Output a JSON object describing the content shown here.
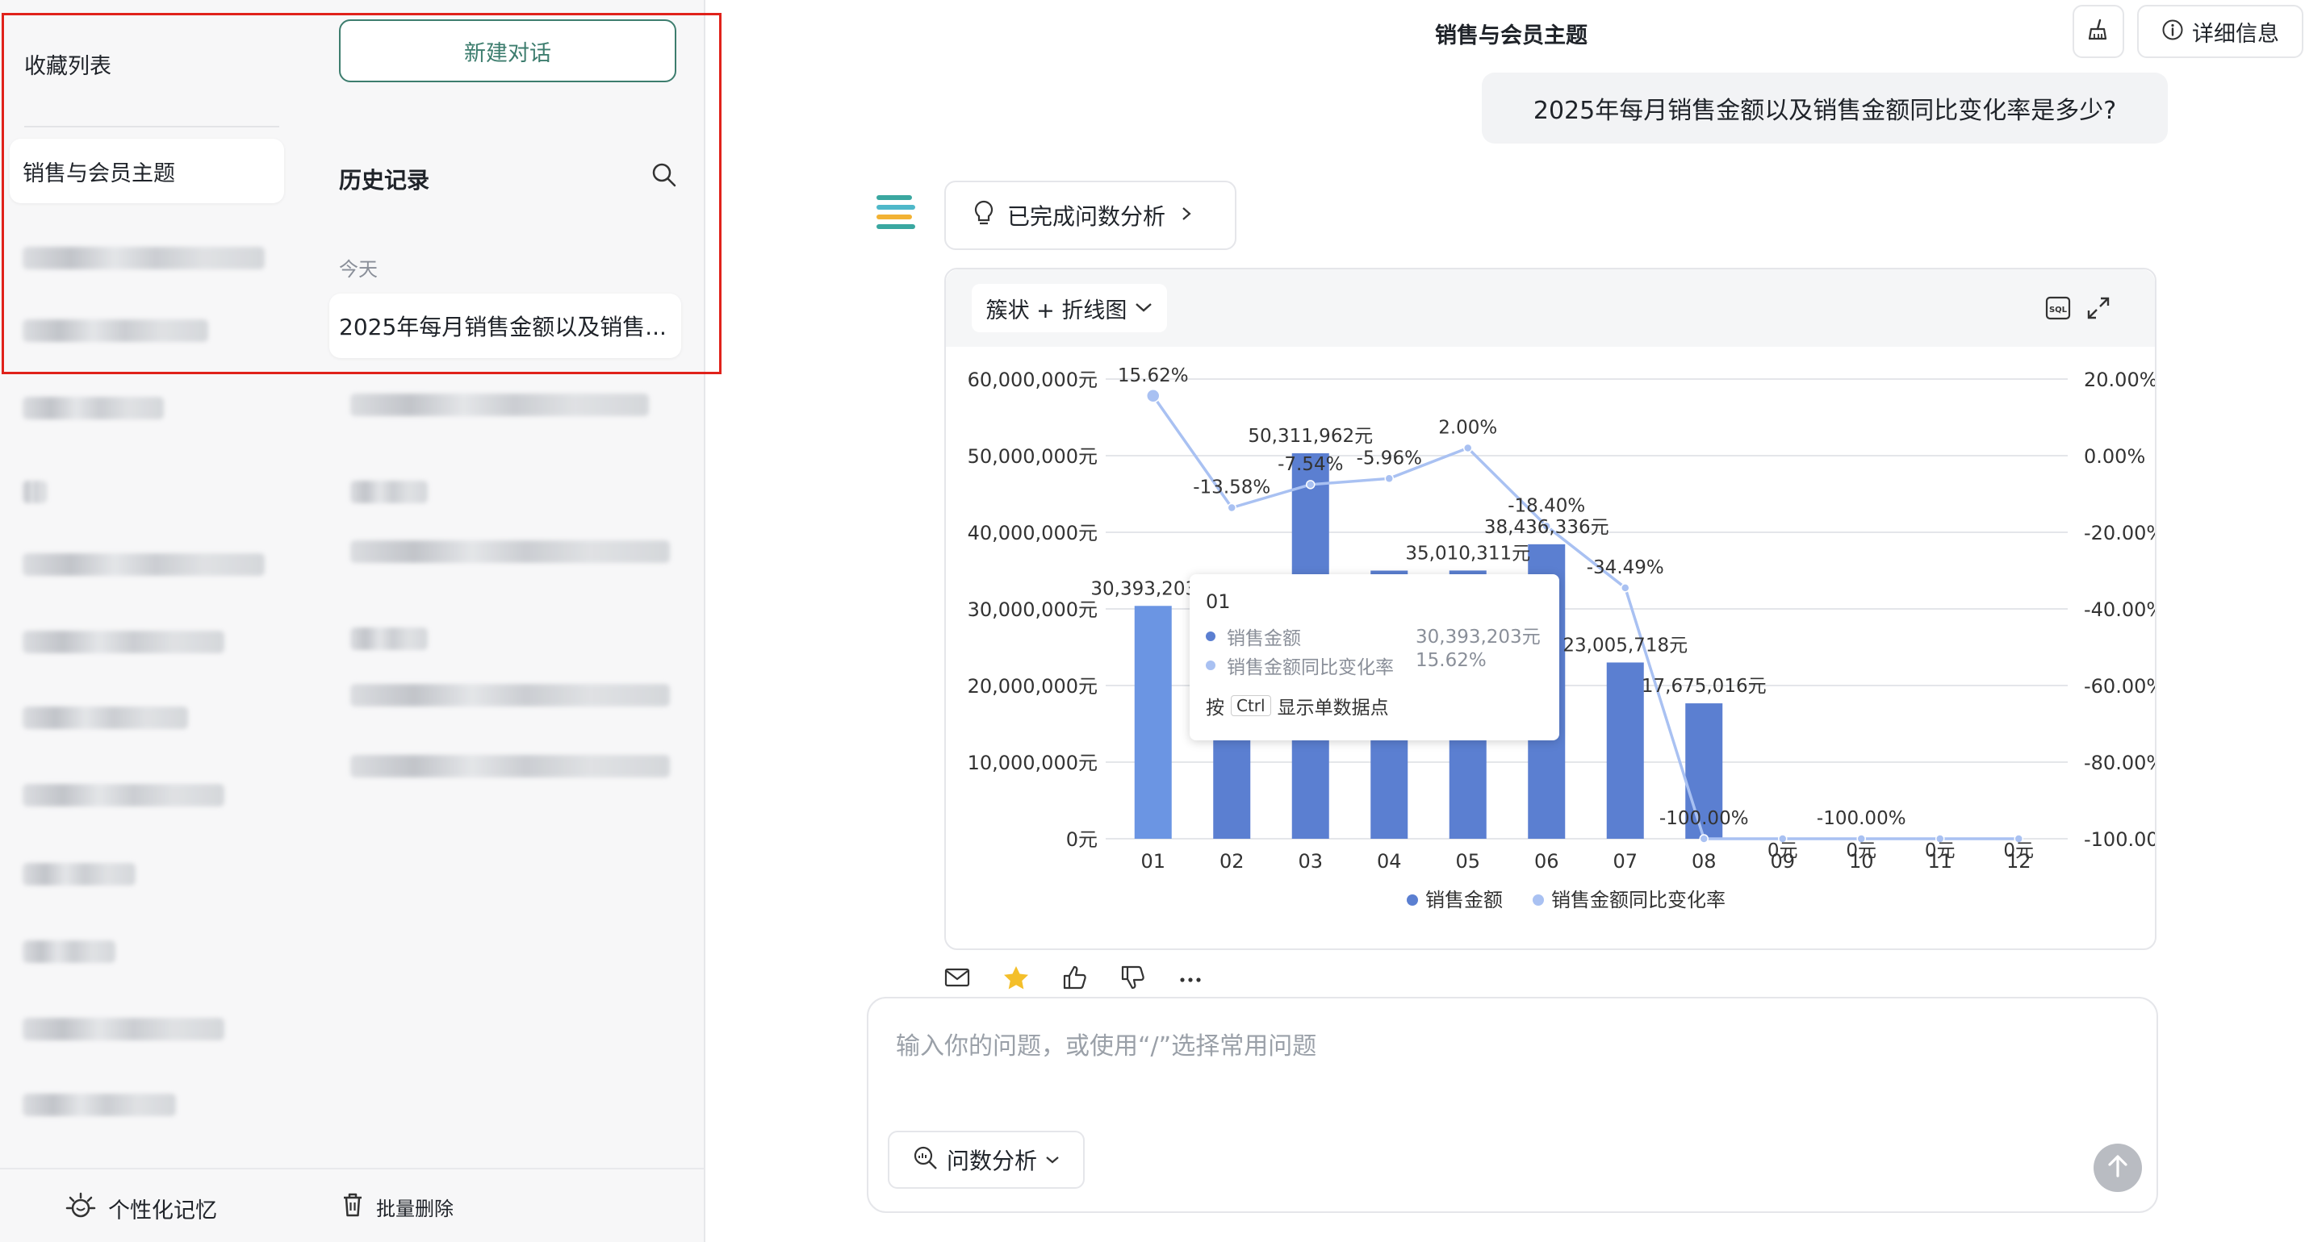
{
  "favorites": {
    "title": "收藏列表",
    "active_item": "销售与会员主题",
    "bottom_label": "个性化记忆"
  },
  "history": {
    "new_chat_label": "新建对话",
    "title": "历史记录",
    "group_today": "今天",
    "active_item": "2025年每月销售金额以及销售...",
    "bulk_delete_label": "批量删除"
  },
  "header": {
    "title": "销售与会员主题",
    "detail_label": "详细信息"
  },
  "conversation": {
    "user_question": "2025年每月销售金额以及销售金额同比变化率是多少?",
    "analysis_status": "已完成问数分析"
  },
  "chart_panel": {
    "chart_type_label": "簇状 + 折线图"
  },
  "chart_data": {
    "type": "bar",
    "categories": [
      "01",
      "02",
      "03",
      "04",
      "05",
      "06",
      "07",
      "08",
      "09",
      "10",
      "11",
      "12"
    ],
    "series": [
      {
        "name": "销售金额",
        "type": "bar",
        "axis": "left",
        "values": [
          30393203,
          26000000,
          50311962,
          35000000,
          35010311,
          38436336,
          23005718,
          17675016,
          0,
          0,
          0,
          0
        ],
        "labels": [
          "30,393,203元",
          "",
          "50,311,962元",
          "",
          "35,010,311元",
          "38,436,336元",
          "23,005,718元",
          "17,675,016元",
          "0元",
          "0元",
          "0元",
          "0元"
        ]
      },
      {
        "name": "销售金额同比变化率",
        "type": "line",
        "axis": "right",
        "values": [
          15.62,
          -13.58,
          -7.54,
          -5.96,
          2.0,
          -18.4,
          -34.49,
          -100.0,
          -100.0,
          -100.0,
          -100.0,
          -100.0
        ],
        "labels": [
          "15.62%",
          "-13.58%",
          "-7.54%",
          "-5.96%",
          "2.00%",
          "-18.40%",
          "-34.49%",
          "-100.00%",
          "",
          "-100.00%",
          "",
          ""
        ]
      }
    ],
    "left_ticks": [
      "60,000,000元",
      "50,000,000元",
      "40,000,000元",
      "30,000,000元",
      "20,000,000元",
      "10,000,000元",
      "0元"
    ],
    "right_ticks": [
      "20.00%",
      "0.00%",
      "-20.00%",
      "-40.00%",
      "-60.00%",
      "-80.00%",
      "-100.00%"
    ],
    "ylim_left": [
      0,
      60000000
    ],
    "ylim_right": [
      -100,
      20
    ],
    "grid": true,
    "legend": "bottom-center",
    "colors": {
      "bar": "#5b7fd1",
      "bar_highlight": "#6b95e3",
      "line": "#a9c1f2"
    },
    "tooltip": {
      "category": "01",
      "row1_name": "销售金额",
      "row1_value": "30,393,203元",
      "row2_name": "销售金额同比变化率",
      "row2_value": "15.62%",
      "hint_prefix": "按",
      "hint_key": "Ctrl",
      "hint_suffix": "显示单数据点"
    }
  },
  "input": {
    "placeholder": "输入你的问题，或使用“/”选择常用问题",
    "mode_label": "问数分析"
  }
}
